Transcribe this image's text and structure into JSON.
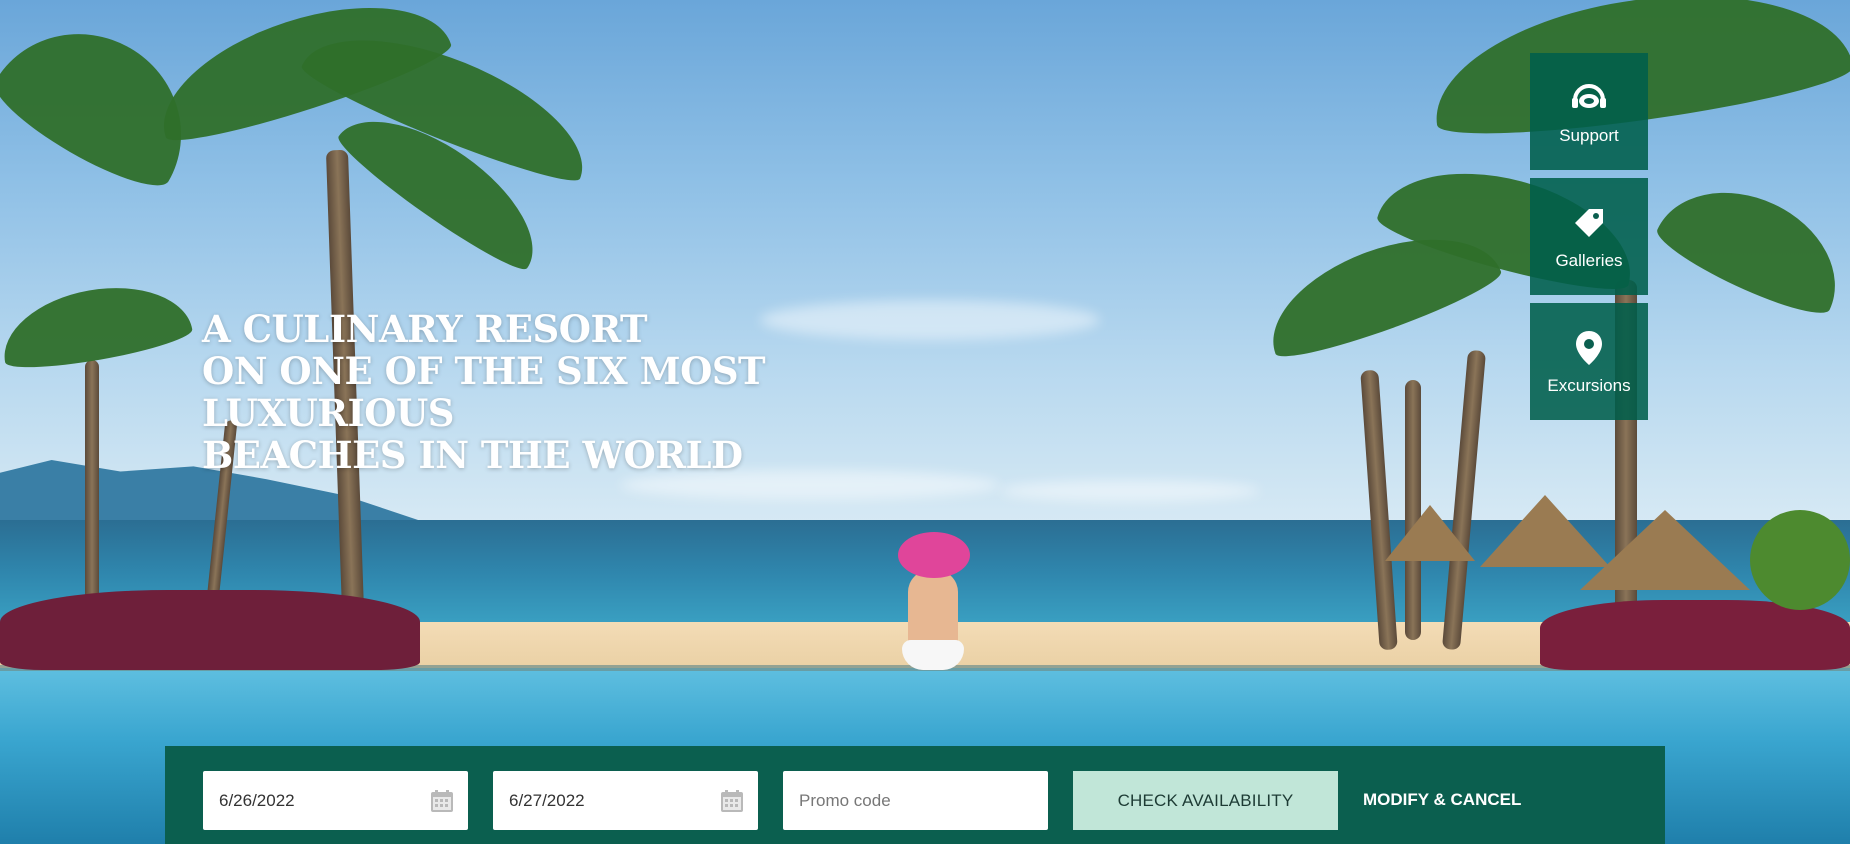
{
  "headline": {
    "line1": "A CULINARY RESORT",
    "line2": "ON ONE OF THE SIX MOST LUXURIOUS",
    "line3": "BEACHES IN THE WORLD"
  },
  "quick_nav": [
    {
      "label": "Support",
      "icon": "support-headset-icon"
    },
    {
      "label": "Galleries",
      "icon": "tag-icon"
    },
    {
      "label": "Excursions",
      "icon": "map-pin-icon"
    }
  ],
  "booking": {
    "check_in": "6/26/2022",
    "check_out": "6/27/2022",
    "promo_placeholder": "Promo code",
    "check_availability_label": "CHECK AVAILABILITY",
    "modify_cancel_label": "MODIFY & CANCEL"
  },
  "colors": {
    "brand_green": "#0b5f4f",
    "button_mint": "#c1e6d8",
    "nav_tile": "#005f4b"
  }
}
